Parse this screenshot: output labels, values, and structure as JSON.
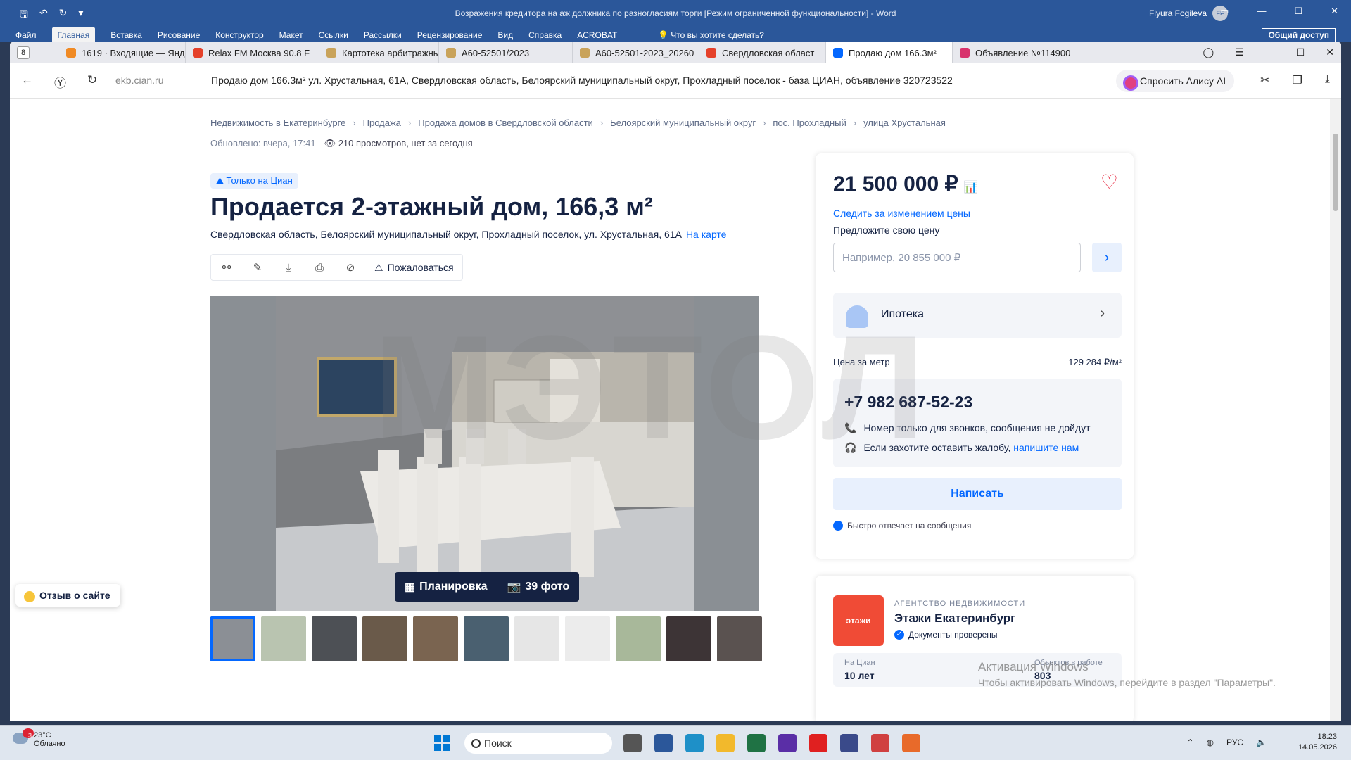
{
  "word": {
    "title": "Возражения кредитора на аж должника по разногласиям торги [Режим ограниченной функциональности]  -  Word",
    "user": "Flyura Fogileva",
    "user_initials": "FF",
    "ribbon_tabs": [
      "Файл",
      "Главная",
      "Вставка",
      "Рисование",
      "Конструктор",
      "Макет",
      "Ссылки",
      "Рассылки",
      "Рецензирование",
      "Вид",
      "Справка",
      "ACROBAT"
    ],
    "tell_me": "Что вы хотите сделать?",
    "share": "Общий доступ"
  },
  "browser": {
    "tab_count": "8",
    "tabs": [
      {
        "label": "1619 · Входящие — Янд",
        "color": "#f08a24"
      },
      {
        "label": "Relax FM Москва 90.8 F",
        "color": "#e5412a"
      },
      {
        "label": "Картотека арбитражны",
        "color": "#c9a35a"
      },
      {
        "label": "А60-52501/2023",
        "color": "#c9a35a"
      },
      {
        "label": "А60-52501-2023_20260",
        "color": "#c9a35a"
      },
      {
        "label": "Свердловская област",
        "color": "#e5412a"
      },
      {
        "label": "Продаю дом 166.3м²",
        "color": "#0468ff"
      },
      {
        "label": "Объявление №114900",
        "color": "#d8336d"
      }
    ],
    "url": "ekb.cian.ru",
    "page_title": "Продаю дом 166.3м² ул. Хрустальная, 61А, Свердловская область, Белоярский муниципальный округ, Прохладный поселок - база ЦИАН, объявление 320723522",
    "alice": "Спросить Алису AI"
  },
  "listing": {
    "breadcrumbs": [
      "Недвижимость в Екатеринбурге",
      "Продажа",
      "Продажа домов в Свердловской области",
      "Белоярский муниципальный округ",
      "пос. Прохладный",
      "улица Хрустальная"
    ],
    "updated": "Обновлено: вчера, 17:41",
    "views": "210 просмотров, нет за сегодня",
    "badge": "Только на Циан",
    "title": "Продается 2-этажный дом, 166,3 м²",
    "address": "Свердловская область, Белоярский муниципальный округ, Прохладный поселок, ул. Хрустальная, 61А",
    "map_link": "На карте",
    "complain": "Пожаловаться",
    "plan_button": "Планировка",
    "photos_button": "39 фото",
    "watermark": "МЭТОЛ",
    "thumb_colors": [
      "#8b8f95",
      "#b9c4b0",
      "#4d5055",
      "#6a5a4a",
      "#7a6450",
      "#4a6070",
      "#e6e6e6",
      "#ececec",
      "#a8b89a",
      "#3d3436",
      "#5a5250"
    ]
  },
  "sidebar": {
    "price": "21 500 000 ₽",
    "follow_price": "Следить за изменением цены",
    "offer_label": "Предложите свою цену",
    "offer_placeholder": "Например, 20 855 000 ₽",
    "mortgage": "Ипотека",
    "price_per_meter_label": "Цена за метр",
    "price_per_meter": "129 284 ₽/м²",
    "phone": "+7 982 687-52-23",
    "calls_only": "Номер только для звонков, сообщения не дойдут",
    "complaint_text": "Если захотите оставить жалобу,",
    "complaint_link": "напишите нам",
    "write": "Написать",
    "fast_reply": "Быстро отвечает на сообщения"
  },
  "agency": {
    "logo": "этажи",
    "kind": "АГЕНТСТВО НЕДВИЖИМОСТИ",
    "name": "Этажи Екатеринбург",
    "verified": "Документы проверены",
    "on_cian_label": "На Циан",
    "on_cian_value": "10 лет",
    "in_work_label": "Объектов в работе",
    "in_work_value": "803"
  },
  "feedback": "Отзыв о сайте",
  "activation": {
    "title": "Активация Windows",
    "subtitle": "Чтобы активировать Windows, перейдите в раздел \"Параметры\"."
  },
  "taskbar": {
    "weather_badge": "3",
    "temp": "23°C",
    "condition": "Облачно",
    "search": "Поиск",
    "lang": "РУС",
    "time": "18:23",
    "date": "14.05.2026",
    "app_colors": [
      "#555",
      "#2b579a",
      "#1e90c8",
      "#f2b92c",
      "#1f7244",
      "#5a2ea6",
      "#e02020",
      "#3a4a8a",
      "#d04040",
      "#e86a2a"
    ]
  }
}
